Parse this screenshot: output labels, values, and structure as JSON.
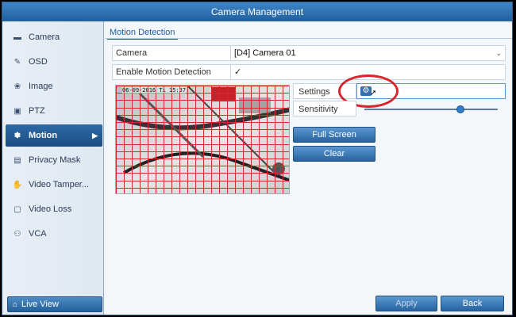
{
  "window": {
    "title": "Camera Management"
  },
  "sidebar": {
    "items": [
      {
        "label": "Camera",
        "icon": "camera-icon",
        "glyph": "■"
      },
      {
        "label": "OSD",
        "icon": "osd-icon",
        "glyph": "✎"
      },
      {
        "label": "Image",
        "icon": "image-icon",
        "glyph": "❀"
      },
      {
        "label": "PTZ",
        "icon": "ptz-icon",
        "glyph": "▣"
      },
      {
        "label": "Motion",
        "icon": "motion-icon",
        "glyph": "✽",
        "active": true
      },
      {
        "label": "Privacy Mask",
        "icon": "privacy-mask-icon",
        "glyph": "▤"
      },
      {
        "label": "Video Tamper...",
        "icon": "video-tamper-icon",
        "glyph": "✋"
      },
      {
        "label": "Video Loss",
        "icon": "video-loss-icon",
        "glyph": "▢"
      },
      {
        "label": "VCA",
        "icon": "vca-icon",
        "glyph": "⚇"
      }
    ],
    "live_view": "Live View"
  },
  "main": {
    "tab": "Motion Detection",
    "camera": {
      "label": "Camera",
      "value": "[D4] Camera 01"
    },
    "enable": {
      "label": "Enable Motion Detection",
      "checked": true
    },
    "preview": {
      "osd": "06-09-2016 Ti 15:37"
    },
    "settings": {
      "label": "Settings"
    },
    "sensitivity": {
      "label": "Sensitivity",
      "level": 0.72
    },
    "buttons": {
      "full_screen": "Full Screen",
      "clear": "Clear"
    }
  },
  "footer": {
    "apply": "Apply",
    "back": "Back"
  },
  "colors": {
    "accent": "#1f5f9e",
    "grid": "#d42a2a",
    "highlight_ring": "#d6262e"
  }
}
